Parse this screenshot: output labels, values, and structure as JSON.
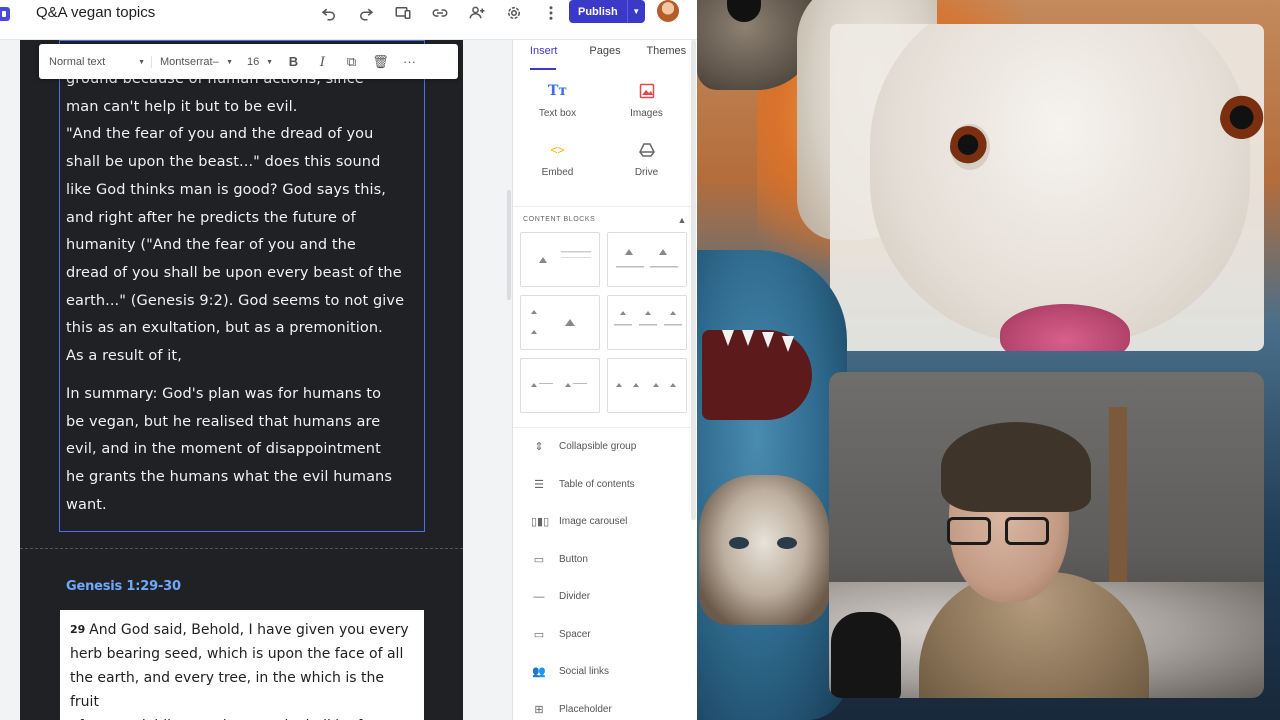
{
  "app": {
    "doc_title": "Q&A vegan topics"
  },
  "toolbar": {
    "icons": [
      "undo-icon",
      "redo-icon",
      "preview-icon",
      "link-icon",
      "share-icon",
      "settings-icon",
      "more-vert-icon"
    ],
    "publish_label": "Publish"
  },
  "format_toolbar": {
    "style": "Normal text",
    "font": "Montserrat–",
    "size": "16",
    "buttons": [
      "bold-icon",
      "italic-icon",
      "copy-icon",
      "delete-icon",
      "more-horiz-icon"
    ]
  },
  "content": {
    "paragraph1_lines": [
      "ground because of human actions, since",
      "man can't help it but to be evil.",
      "\"And the fear of you and the dread of you",
      "shall be upon the beast...\" does this sound",
      "like God thinks man is good? God says this,",
      "and right after he predicts the future of",
      "humanity (\"And the fear of you and the",
      "dread of you shall be upon every beast of the",
      "earth...\" (Genesis 9:2). God seems to not give",
      "this as an exultation, but as a premonition.",
      "As a result of it,"
    ],
    "paragraph2_lines": [
      "In summary: God's plan was for humans to",
      "be vegan, but he realised that humans are",
      "evil, and in the moment of disappointment",
      "he grants the humans what the evil humans",
      "want."
    ],
    "section_heading": "Genesis 1:29-30",
    "verse_number": "29",
    "verse_lines": [
      "And God said, Behold, I have given you every",
      "herb bearing seed, which is upon the face of all",
      "the earth, and every tree, in the which is the fruit",
      "of a tree yielding seed; to you it shall be for"
    ]
  },
  "panel": {
    "tabs": [
      "Insert",
      "Pages",
      "Themes"
    ],
    "active_tab": "Insert",
    "insert_items": [
      {
        "label": "Text box",
        "icon": "text-box-icon"
      },
      {
        "label": "Images",
        "icon": "image-icon"
      },
      {
        "label": "Embed",
        "icon": "embed-icon"
      },
      {
        "label": "Drive",
        "icon": "drive-icon"
      }
    ],
    "content_blocks_label": "CONTENT BLOCKS",
    "components": [
      {
        "label": "Collapsible group",
        "icon": "collapsible-group-icon"
      },
      {
        "label": "Table of contents",
        "icon": "table-of-contents-icon"
      },
      {
        "label": "Image carousel",
        "icon": "image-carousel-icon"
      },
      {
        "label": "Button",
        "icon": "button-icon"
      },
      {
        "label": "Divider",
        "icon": "divider-icon"
      },
      {
        "label": "Spacer",
        "icon": "spacer-icon"
      },
      {
        "label": "Social links",
        "icon": "social-links-icon"
      },
      {
        "label": "Placeholder",
        "icon": "placeholder-icon"
      }
    ]
  },
  "colors": {
    "accent": "#3b39c8",
    "page_bg": "#202124",
    "heading_link": "#6ea8ff",
    "selection": "#4f6ef7"
  }
}
